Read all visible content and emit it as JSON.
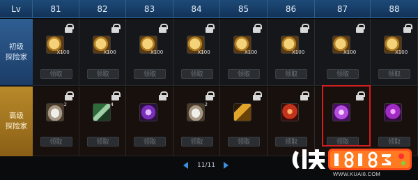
{
  "header": {
    "lv_label": "Lv",
    "levels": [
      "81",
      "82",
      "83",
      "84",
      "85",
      "86",
      "87",
      "88"
    ]
  },
  "rows": [
    {
      "label": "初级\n探险家",
      "items": [
        {
          "icon": "gold-coin-pouch-icon",
          "qty": "X100",
          "claim": "领取",
          "locked": true
        },
        {
          "icon": "gold-coin-pouch-icon",
          "qty": "X100",
          "claim": "领取",
          "locked": true
        },
        {
          "icon": "gold-coin-pouch-icon",
          "qty": "X100",
          "claim": "领取",
          "locked": true
        },
        {
          "icon": "gold-coin-pouch-icon",
          "qty": "X100",
          "claim": "领取",
          "locked": true
        },
        {
          "icon": "gold-coin-pouch-icon",
          "qty": "X100",
          "claim": "领取",
          "locked": true
        },
        {
          "icon": "gold-coin-pouch-icon",
          "qty": "X100",
          "claim": "领取",
          "locked": true
        },
        {
          "icon": "gold-coin-pouch-icon",
          "qty": "X100",
          "claim": "领取",
          "locked": true
        },
        {
          "icon": "gold-coin-pouch-icon",
          "qty": "X100",
          "claim": "领取",
          "locked": true
        }
      ]
    },
    {
      "label": "高级\n探险家",
      "items": [
        {
          "icon": "silver-ingot-icon",
          "qty": "2",
          "claim": "领取",
          "locked": true
        },
        {
          "icon": "ticket-stack-icon",
          "qty": "4",
          "claim": "领取",
          "locked": true
        },
        {
          "icon": "purple-scroll-icon",
          "qty": "",
          "claim": "领取",
          "locked": true
        },
        {
          "icon": "silver-ingot-icon",
          "qty": "2",
          "claim": "领取",
          "locked": true
        },
        {
          "icon": "golden-key-icon",
          "qty": "",
          "claim": "领取",
          "locked": true
        },
        {
          "icon": "red-armor-icon",
          "qty": "",
          "claim": "领取",
          "locked": true
        },
        {
          "icon": "purple-charm-icon",
          "qty": "",
          "claim": "领取",
          "locked": true
        },
        {
          "icon": "purple-armor-icon",
          "qty": "",
          "claim": "领取",
          "locked": false
        }
      ]
    }
  ],
  "pager": {
    "text": "11/11"
  },
  "watermark": {
    "url": "WWW.KUAI8.COM",
    "brand": "快 18183"
  },
  "colors": {
    "header_bg": "#1d4a78",
    "basic_label_bg": "#2f5e93",
    "advanced_label_bg": "#b98a2a",
    "highlight": "#d51f1f",
    "pager_arrow": "#3d8fe0"
  }
}
